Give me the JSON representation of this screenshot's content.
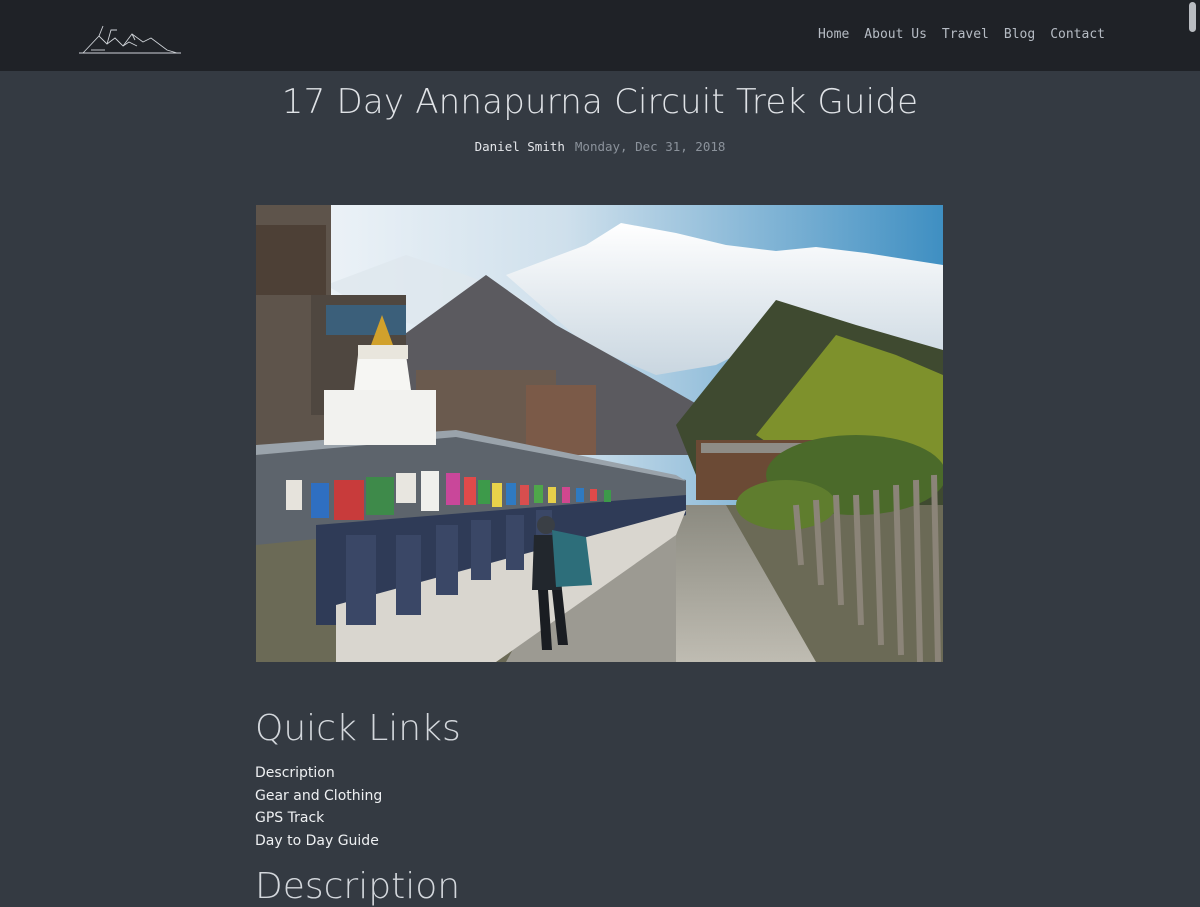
{
  "nav": {
    "logo_icon": "mountain-sketch-logo",
    "items": [
      "Home",
      "About Us",
      "Travel",
      "Blog",
      "Contact"
    ]
  },
  "post": {
    "title": "17 Day Annapurna Circuit Trek Guide",
    "author": "Daniel Smith",
    "date": "Monday, Dec 31, 2018"
  },
  "hero_image": {
    "subject": "trekker-passing-prayer-wheels-in-himalayan-village"
  },
  "quick_links": {
    "heading": "Quick Links",
    "items": [
      "Description",
      "Gear and Clothing",
      "GPS Track",
      "Day to Day Guide"
    ]
  },
  "description": {
    "heading": "Description"
  },
  "colors": {
    "page_bg": "#343a42",
    "header_bg": "#1f2227",
    "nav_text": "#b6bcc4"
  }
}
